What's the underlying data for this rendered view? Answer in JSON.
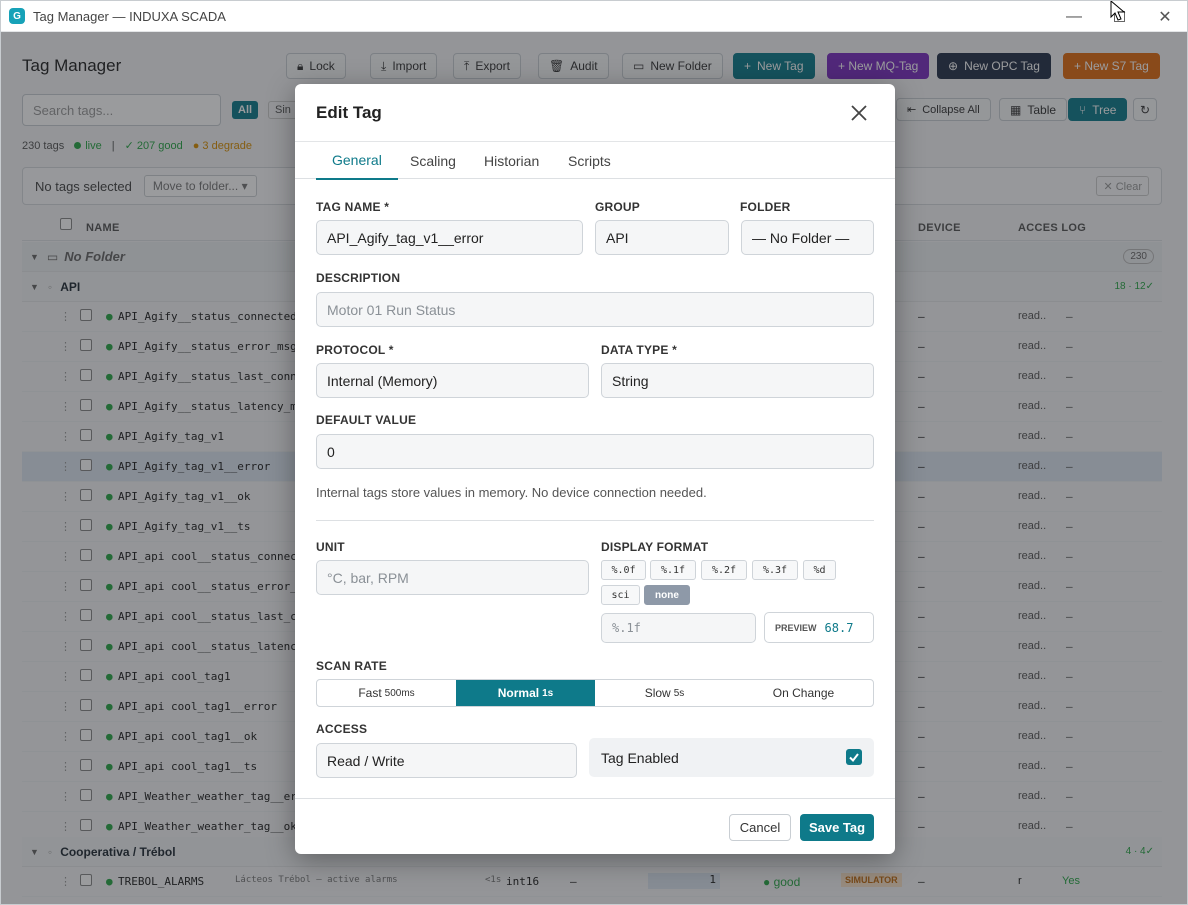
{
  "window": {
    "title": "Tag Manager — INDUXA SCADA",
    "app_icon": "G"
  },
  "page": {
    "title": "Tag Manager"
  },
  "toolbar": {
    "lock": "Lock",
    "import": "Import",
    "export": "Export",
    "audit": "Audit",
    "new_folder": "New Folder",
    "new_tag": "New Tag",
    "new_mq_tag": "+ New MQ-Tag",
    "new_opc_tag": "New OPC Tag",
    "new_s7_tag": "+ New S7 Tag"
  },
  "search": {
    "placeholder": "Search tags..."
  },
  "filters": {
    "all": "All",
    "sim": "Sin"
  },
  "view": {
    "collapse_all": "Collapse All",
    "table": "Table",
    "tree": "Tree"
  },
  "stats": {
    "count": "230 tags",
    "live": "live",
    "sep": "|",
    "good": "✓ 207 good",
    "degraded": "● 3 degrade"
  },
  "selection": {
    "text": "No tags selected",
    "move_placeholder": "Move to folder...",
    "clear": "✕ Clear"
  },
  "table": {
    "headers": {
      "name": "NAME",
      "device": "DEVICE",
      "access_log": "ACCES LOG"
    },
    "no_folder": {
      "label": "No Folder",
      "count": "230"
    },
    "groups": [
      {
        "name": "API",
        "stats": "18 · 12✓"
      },
      {
        "name": "Cooperativa / Trébol",
        "stats": "4 · 4✓"
      }
    ],
    "rows": [
      {
        "name": "API_Agify__status_connected",
        "device": "—",
        "access": "read..",
        "log": "—"
      },
      {
        "name": "API_Agify__status_error_msg",
        "device": "—",
        "access": "read..",
        "log": "—"
      },
      {
        "name": "API_Agify__status_last_conn",
        "device": "—",
        "access": "read..",
        "log": "—"
      },
      {
        "name": "API_Agify__status_latency_m",
        "device": "—",
        "access": "read..",
        "log": "—"
      },
      {
        "name": "API_Agify_tag_v1",
        "device": "—",
        "access": "read..",
        "log": "—"
      },
      {
        "name": "API_Agify_tag_v1__error",
        "device": "—",
        "access": "read..",
        "log": "—"
      },
      {
        "name": "API_Agify_tag_v1__ok",
        "device": "—",
        "access": "read..",
        "log": "—"
      },
      {
        "name": "API_Agify_tag_v1__ts",
        "device": "—",
        "access": "read..",
        "log": "—"
      },
      {
        "name": "API_api cool__status_connec",
        "device": "—",
        "access": "read..",
        "log": "—"
      },
      {
        "name": "API_api cool__status_error_",
        "device": "—",
        "access": "read..",
        "log": "—"
      },
      {
        "name": "API_api cool__status_last_c",
        "device": "—",
        "access": "read..",
        "log": "—"
      },
      {
        "name": "API_api cool__status_latenc",
        "device": "—",
        "access": "read..",
        "log": "—"
      },
      {
        "name": "API_api cool_tag1",
        "device": "—",
        "access": "read..",
        "log": "—"
      },
      {
        "name": "API_api cool_tag1__error",
        "device": "—",
        "access": "read..",
        "log": "—"
      },
      {
        "name": "API_api cool_tag1__ok",
        "device": "—",
        "access": "read..",
        "log": "—"
      },
      {
        "name": "API_api cool_tag1__ts",
        "device": "—",
        "access": "read..",
        "log": "—"
      },
      {
        "name": "API_Weather_weather_tag__er",
        "device": "—",
        "access": "read..",
        "log": "—"
      },
      {
        "name": "API_Weather_weather_tag__ok",
        "device": "—",
        "access": "read..",
        "log": "—"
      }
    ],
    "trebol_row": {
      "name": "TREBOL_ALARMS",
      "desc": "Lácteos Trébol — active alarms",
      "scan": "<1s",
      "type": "int16",
      "dash": "–",
      "value": "1",
      "quality": "● good",
      "source": "SIMULATOR",
      "device": "—",
      "access": "r",
      "log": "Yes"
    }
  },
  "modal": {
    "title": "Edit Tag",
    "tabs": [
      "General",
      "Scaling",
      "Historian",
      "Scripts"
    ],
    "tag_name": {
      "label": "TAG NAME *",
      "value": "API_Agify_tag_v1__error"
    },
    "group": {
      "label": "GROUP",
      "value": "API"
    },
    "folder": {
      "label": "FOLDER",
      "value": "— No Folder —"
    },
    "description": {
      "label": "DESCRIPTION",
      "placeholder": "Motor 01 Run Status"
    },
    "protocol": {
      "label": "PROTOCOL *",
      "value": "Internal (Memory)"
    },
    "data_type": {
      "label": "DATA TYPE *",
      "value": "String"
    },
    "default_value": {
      "label": "DEFAULT VALUE",
      "value": "0"
    },
    "hint": "Internal tags store values in memory. No device connection needed.",
    "unit": {
      "label": "UNIT",
      "placeholder": "°C, bar, RPM"
    },
    "display_format": {
      "label": "DISPLAY FORMAT",
      "options": [
        "%.0f",
        "%.1f",
        "%.2f",
        "%.3f",
        "%d",
        "sci",
        "none"
      ],
      "selected": "none",
      "custom_placeholder": "%.1f",
      "preview_label": "PREVIEW",
      "preview_value": "68.7"
    },
    "scan_rate": {
      "label": "SCAN RATE",
      "options": [
        {
          "label": "Fast",
          "sub": "500ms"
        },
        {
          "label": "Normal",
          "sub": "1s"
        },
        {
          "label": "Slow",
          "sub": "5s"
        },
        {
          "label": "On Change",
          "sub": ""
        }
      ],
      "selected": "Normal"
    },
    "access": {
      "label": "ACCESS",
      "value": "Read / Write"
    },
    "enabled": {
      "label": "Tag Enabled",
      "checked": true
    },
    "cancel": "Cancel",
    "save": "Save Tag"
  },
  "colors": {
    "accent": "#0e7a8a",
    "purple": "#7b2fbf",
    "dark": "#25324a",
    "orange": "#e06c12",
    "good": "#28a745"
  }
}
